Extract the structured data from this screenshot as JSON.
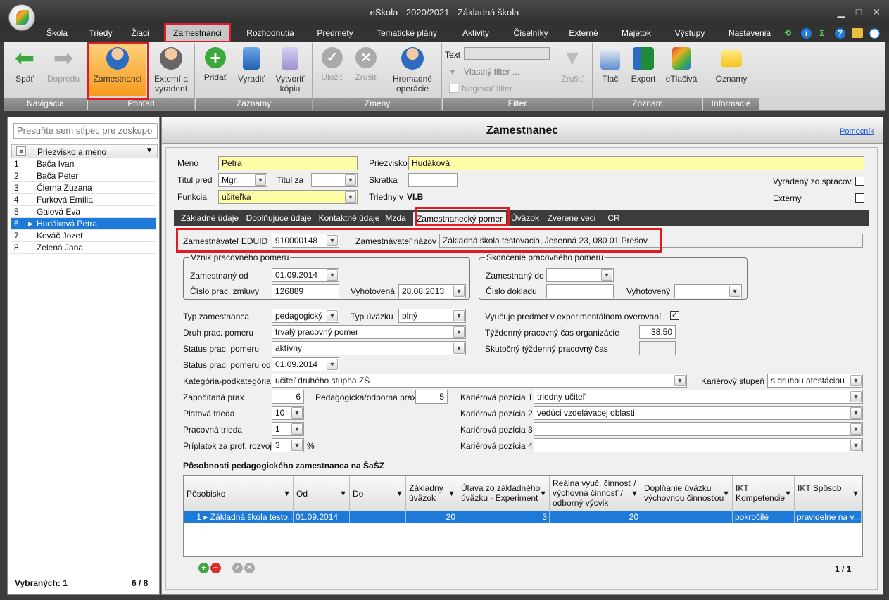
{
  "app": {
    "title": "eŠkola - 2020/2021 - Základná škola"
  },
  "menu": [
    "Škola",
    "Triedy",
    "Žiaci",
    "Zamestnanci",
    "Rozhodnutia",
    "Predmety",
    "Tematické plány",
    "Aktivity",
    "Číselníky",
    "Externé",
    "Majetok",
    "Výstupy",
    "Nastavenia"
  ],
  "ribbon": {
    "groups": [
      "Navigácia",
      "Pohľad",
      "Záznamy",
      "Zmeny",
      "Filter",
      "Zoznam",
      "Informácie"
    ],
    "back": "Späť",
    "forward": "Dopredu",
    "employees": "Zamestnanci",
    "external": "Externí a vyradení",
    "add": "Pridať",
    "remove": "Vyradiť",
    "copy": "Vytvoriť kópiu",
    "save": "Uložiť",
    "cancel": "Zrušiť",
    "bulk": "Hromadné operácie",
    "text_label": "Text",
    "custom_filter": "Vlastný filter ...",
    "negate_filter": "Negovať filter",
    "filter_cancel": "Zrušiť",
    "print": "Tlač",
    "export": "Export",
    "eprint": "eTlačivá",
    "notices": "Oznamy"
  },
  "left": {
    "group_placeholder": "Presuňte sem stĺpec pre zoskupo",
    "col_header": "Priezvisko a meno",
    "rows": [
      {
        "n": "1",
        "name": "Bača Ivan"
      },
      {
        "n": "2",
        "name": "Bača Peter"
      },
      {
        "n": "3",
        "name": "Čierna Zuzana"
      },
      {
        "n": "4",
        "name": "Furková Emília"
      },
      {
        "n": "5",
        "name": "Galová Eva"
      },
      {
        "n": "6",
        "name": "Hudáková Petra"
      },
      {
        "n": "7",
        "name": "Kováč Jozef"
      },
      {
        "n": "8",
        "name": "Zelená Jana"
      }
    ],
    "selected_label": "Vybraných: 1",
    "count": "6 / 8"
  },
  "panel": {
    "title": "Zamestnanec",
    "help": "Pomocník"
  },
  "person": {
    "first_name_label": "Meno",
    "first_name": "Petra",
    "last_name_label": "Priezvisko",
    "last_name": "Hudáková",
    "title_before_label": "Titul pred",
    "title_before": "Mgr.",
    "title_after_label": "Titul za",
    "title_after": "",
    "abbrev_label": "Skratka",
    "abbrev": "",
    "retired_label": "Vyradený zo spracov.",
    "function_label": "Funkcia",
    "function": "učiteľka",
    "class_teacher_label": "Triedny v",
    "class_teacher": "VI.B",
    "external_label": "Externý"
  },
  "tabs": [
    "Základné údaje",
    "Doplňujúce údaje",
    "Kontaktné údaje",
    "Mzda",
    "Zamestnanecký pomer",
    "Úväzok",
    "Zverené veci",
    "CR"
  ],
  "employment": {
    "eduid_label": "Zamestnávateľ EDUID",
    "eduid": "910000148",
    "employer_name_label": "Zamestnávateľ názov",
    "employer_name": "Základná škola testovacia, Jesenná 23, 080 01 Prešov",
    "start_legend": "Vznik pracovného pomeru",
    "employed_from_label": "Zamestnaný od",
    "employed_from": "01.09.2014",
    "contract_no_label": "Číslo prac. zmluvy",
    "contract_no": "126889",
    "issued_label": "Vyhotovená",
    "issued": "28.08.2013",
    "end_legend": "Skončenie pracovného pomeru",
    "employed_to_label": "Zamestnaný do",
    "employed_to": "",
    "doc_no_label": "Číslo dokladu",
    "doc_no": "",
    "issued_end_label": "Vyhotovený",
    "issued_end": "",
    "type_label": "Typ zamestnanca",
    "type": "pedagogický",
    "workload_type_label": "Typ úväzku",
    "workload_type": "plný",
    "experimental_label": "Vyučuje predmet v experimentálnom overovaní",
    "kind_label": "Druh prac. pomeru",
    "kind": "trvalý pracovný pomer",
    "weekly_org_label": "Týždenný pracovný čas organizácie",
    "weekly_org": "38,50",
    "status_label": "Status prac. pomeru",
    "status": "aktívny",
    "weekly_actual_label": "Skutočný týždenný pracovný čas",
    "weekly_actual": "",
    "status_from_label": "Status prac. pomeru od",
    "status_from": "01.09.2014",
    "category_label": "Kategória-podkategória",
    "category": "učiteľ druhého stupňa ZŠ",
    "career_level_label": "Kariérový stupeň",
    "career_level": "s druhou atestáciou",
    "counted_practice_label": "Započítaná prax",
    "counted_practice": "6",
    "ped_practice_label": "Pedagogická/odborná prax",
    "ped_practice": "5",
    "career_pos1_label": "Kariérová pozícia 1",
    "career_pos1": "triedny učiteľ",
    "salary_class_label": "Platová trieda",
    "salary_class": "10",
    "career_pos2_label": "Kariérová pozícia 2",
    "career_pos2": "vedúci vzdelávacej oblasti",
    "work_class_label": "Pracovná trieda",
    "work_class": "1",
    "career_pos3_label": "Kariérová pozícia 3",
    "career_pos3": "",
    "bonus_label": "Príplatok za prof. rozvoj",
    "bonus": "3",
    "bonus_unit": "%",
    "career_pos4_label": "Kariérová pozícia 4",
    "career_pos4": ""
  },
  "scope": {
    "title": "Pôsobnosti pedagogického zamestnanca na ŠaŠZ",
    "columns": [
      "Pôsobisko",
      "Od",
      "Do",
      "Základný úväzok",
      "Úľava zo základného úväzku - Experiment",
      "Reálna vyuč. činnosť / výchovná činnosť / odborný výcvik",
      "Doplňanie úväzku výchovnou činnosťou",
      "IKT Kompetencie",
      "IKT Spôsob"
    ],
    "rows": [
      {
        "n": "1",
        "place": "Základná škola testo...",
        "from": "01.09.2014",
        "to": "",
        "base": "20",
        "relief": "3",
        "real": "20",
        "fill": "",
        "ict": "pokročilé",
        "ict_way": "pravidelne na v..."
      }
    ],
    "pager": "1 / 1"
  },
  "accent": "#1e7ad8",
  "highlight": "#e01b24"
}
